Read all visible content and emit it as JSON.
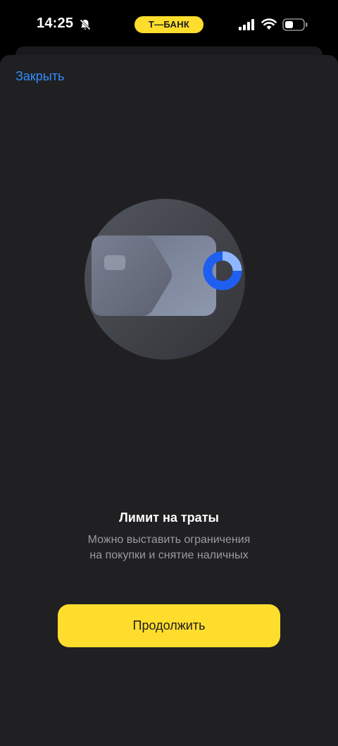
{
  "status_bar": {
    "time": "14:25",
    "brand": "Т—БАНК"
  },
  "sheet": {
    "close_label": "Закрыть",
    "title": "Лимит на траты",
    "subtitle_line1": "Можно выставить ограничения",
    "subtitle_line2": "на покупки и снятие наличных",
    "continue_label": "Продолжить"
  },
  "colors": {
    "accent_link": "#2f8cff",
    "brand_yellow": "#ffdd2d",
    "sheet_background": "#202022"
  },
  "icons": [
    "bell-slash-icon",
    "signal-icon",
    "wifi-icon",
    "battery-icon",
    "card-limit-illustration"
  ]
}
